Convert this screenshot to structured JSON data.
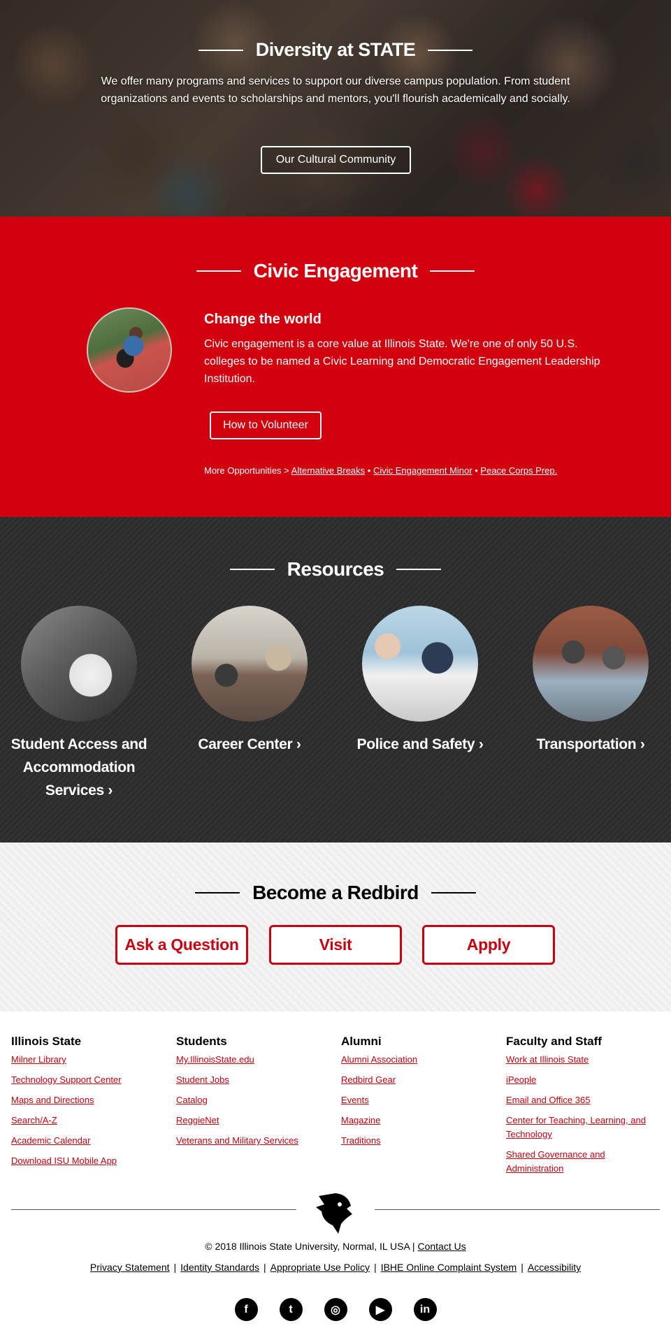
{
  "hero": {
    "title": "Diversity at STATE",
    "body": "We offer many programs and services to support our diverse campus population. From student organizations and events to scholarships and mentors, you'll flourish academically and socially.",
    "button": "Our Cultural Community"
  },
  "civic": {
    "title": "Civic Engagement",
    "subtitle": "Change the world",
    "body": "Civic engagement is a core value at Illinois State. We're one of only 50 U.S. colleges to be named a Civic Learning and Democratic Engagement Leadership Institution.",
    "button": "How to Volunteer",
    "more_label": "More Opportunities >",
    "links": [
      "Alternative Breaks",
      "Civic Engagement Minor",
      "Peace Corps Prep."
    ],
    "bullet": "•"
  },
  "resources": {
    "title": "Resources",
    "items": [
      {
        "label": "Student Access and Accommodation Services ›"
      },
      {
        "label": "Career Center ›"
      },
      {
        "label": "Police and Safety ›"
      },
      {
        "label": "Transportation ›"
      }
    ]
  },
  "redbird": {
    "title": "Become a Redbird",
    "buttons": [
      "Ask a Question",
      "Visit",
      "Apply"
    ]
  },
  "footer": {
    "columns": [
      {
        "heading": "Illinois State",
        "links": [
          "Milner Library",
          "Technology Support Center",
          "Maps and Directions",
          "Search/A-Z",
          "Academic Calendar",
          "Download ISU Mobile App"
        ]
      },
      {
        "heading": "Students",
        "links": [
          "My.IllinoisState.edu",
          "Student Jobs",
          "Catalog",
          "ReggieNet",
          "Veterans and Military Services"
        ]
      },
      {
        "heading": "Alumni",
        "links": [
          "Alumni Association",
          "Redbird Gear",
          "Events",
          "Magazine",
          "Traditions"
        ]
      },
      {
        "heading": "Faculty and Staff",
        "links": [
          "Work at Illinois State",
          "iPeople",
          "Email and Office 365",
          "Center for Teaching, Learning, and Technology",
          "Shared Governance and Administration"
        ]
      }
    ],
    "copyright": "© 2018 Illinois State University, Normal, IL USA |",
    "contact": "Contact Us",
    "legal": [
      "Privacy Statement",
      "Identity Standards",
      "Appropriate Use Policy",
      "IBHE Online Complaint System",
      "Accessibility"
    ],
    "legal_sep": "|",
    "social": [
      {
        "name": "facebook-icon",
        "glyph": "f"
      },
      {
        "name": "twitter-icon",
        "glyph": "t"
      },
      {
        "name": "instagram-icon",
        "glyph": "◎"
      },
      {
        "name": "youtube-icon",
        "glyph": "▶"
      },
      {
        "name": "linkedin-icon",
        "glyph": "in"
      }
    ]
  },
  "colors": {
    "brand_red": "#d2000f",
    "dark": "#2b2b2b"
  }
}
